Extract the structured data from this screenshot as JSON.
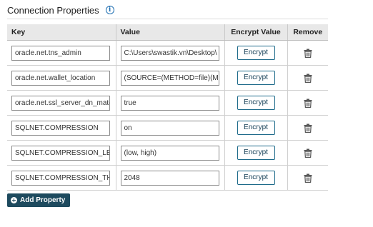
{
  "section": {
    "title": "Connection Properties",
    "info_icon": "info-icon"
  },
  "table": {
    "headers": {
      "key": "Key",
      "value": "Value",
      "encrypt": "Encrypt Value",
      "remove": "Remove"
    },
    "rows": [
      {
        "key": "oracle.net.tns_admin",
        "value": "C:\\Users\\swastik.vn\\Desktop\\",
        "encrypt_label": "Encrypt",
        "remove_icon": "trash-icon"
      },
      {
        "key": "oracle.net.wallet_location",
        "value": "(SOURCE=(METHOD=file)(METHOD_DATA=",
        "encrypt_label": "Encrypt",
        "remove_icon": "trash-icon"
      },
      {
        "key": "oracle.net.ssl_server_dn_match",
        "value": "true",
        "encrypt_label": "Encrypt",
        "remove_icon": "trash-icon"
      },
      {
        "key": "SQLNET.COMPRESSION",
        "value": "on",
        "encrypt_label": "Encrypt",
        "remove_icon": "trash-icon"
      },
      {
        "key": "SQLNET.COMPRESSION_LEVELS",
        "value": "(low, high)",
        "encrypt_label": "Encrypt",
        "remove_icon": "trash-icon"
      },
      {
        "key": "SQLNET.COMPRESSION_THRESHOLD",
        "value": "2048",
        "encrypt_label": "Encrypt",
        "remove_icon": "trash-icon"
      }
    ]
  },
  "add_button": {
    "label": "Add Property",
    "icon": "plus-circle-icon"
  },
  "colors": {
    "primary_dark": "#1d4a5e",
    "encrypt_border": "#1d6a8a",
    "header_bg": "#e8e8e8",
    "info_blue": "#1f6fb2"
  }
}
